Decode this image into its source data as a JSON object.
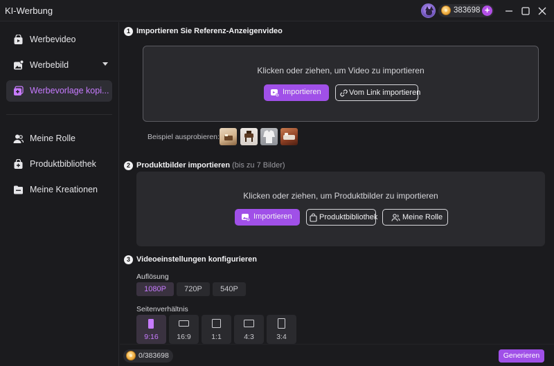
{
  "app": {
    "title": "KI-Werbung"
  },
  "header": {
    "credits": "383698"
  },
  "sidebar": {
    "items": [
      {
        "label": "Werbevideo"
      },
      {
        "label": "Werbebild"
      },
      {
        "label": "Werbevorlage kopi..."
      },
      {
        "label": "Meine Rolle"
      },
      {
        "label": "Produktbibliothek"
      },
      {
        "label": "Meine Kreationen"
      }
    ]
  },
  "step1": {
    "number": "1",
    "title": "Importieren Sie Referenz-Anzeigenvideo",
    "drop_text": "Klicken oder ziehen, um Video zu importieren",
    "import_label": "Importieren",
    "link_label": "Vom Link importieren",
    "samples_label": "Beispiel ausprobieren:"
  },
  "step2": {
    "number": "2",
    "title": "Produktbilder importieren",
    "hint": "(bis zu 7 Bilder)",
    "drop_text": "Klicken oder ziehen, um Produktbilder zu importieren",
    "import_label": "Importieren",
    "library_label": "Produktbibliothek",
    "role_label": "Meine Rolle"
  },
  "step3": {
    "number": "3",
    "title": "Videoeinstellungen konfigurieren",
    "resolution_label": "Auflösung",
    "resolutions": [
      "1080P",
      "720P",
      "540P"
    ],
    "selected_resolution": "1080P",
    "aspect_label": "Seitenverhältnis",
    "aspects": [
      "9:16",
      "16:9",
      "1:1",
      "4:3",
      "3:4"
    ],
    "selected_aspect": "9:16"
  },
  "footer": {
    "usage": "0/383698",
    "generate_label": "Generieren"
  },
  "colors": {
    "accent": "#a050e8",
    "accent_text": "#c77bff",
    "background": "#1b1b1e",
    "panel": "#2a2a2e"
  }
}
